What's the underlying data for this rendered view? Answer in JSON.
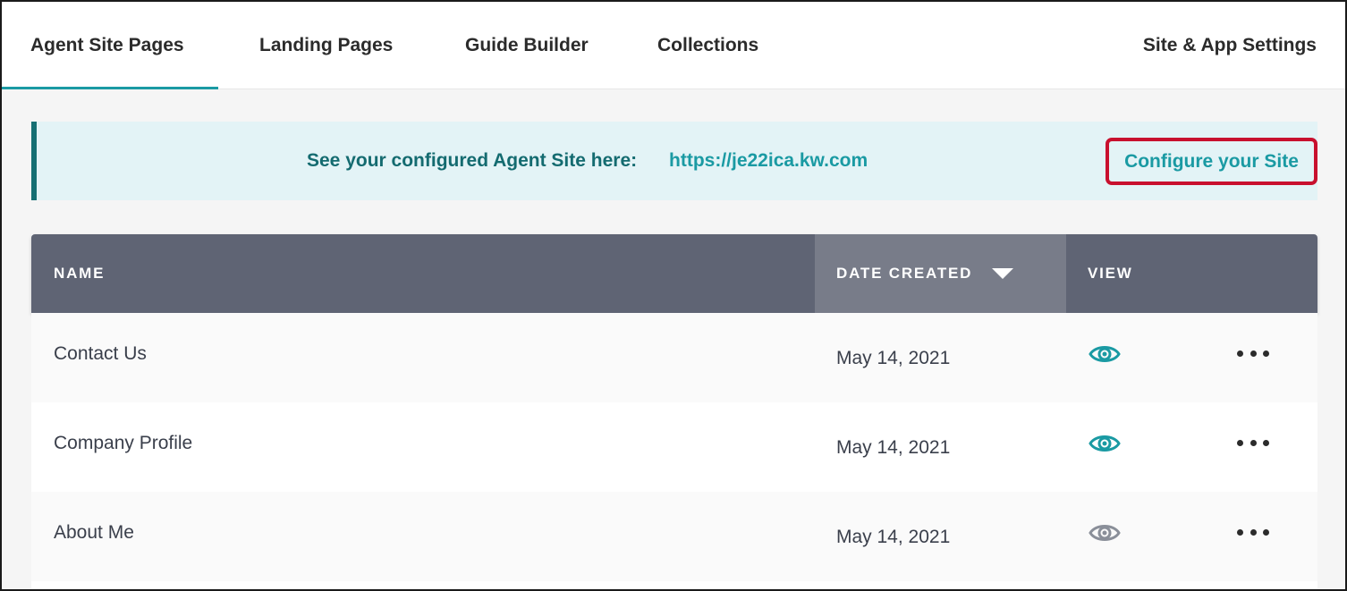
{
  "nav": {
    "tabs": [
      {
        "label": "Agent Site Pages",
        "active": true
      },
      {
        "label": "Landing Pages",
        "active": false
      },
      {
        "label": "Guide Builder",
        "active": false
      },
      {
        "label": "Collections",
        "active": false
      }
    ],
    "settings_label": "Site & App Settings"
  },
  "banner": {
    "text": "See your configured Agent Site here:",
    "link": "https://je22ica.kw.com",
    "configure_label": "Configure your Site"
  },
  "table": {
    "columns": {
      "name": "NAME",
      "date_created": "DATE CREATED",
      "view": "VIEW"
    },
    "sort_icon": "caret-down-icon",
    "rows": [
      {
        "name": "Contact Us",
        "date": "May 14, 2021",
        "view_icon": "eye-icon",
        "view_state": "active"
      },
      {
        "name": "Company Profile",
        "date": "May 14, 2021",
        "view_icon": "eye-icon",
        "view_state": "active"
      },
      {
        "name": "About Me",
        "date": "May 14, 2021",
        "view_icon": "eye-icon",
        "view_state": "inactive"
      }
    ]
  },
  "colors": {
    "accent": "#1a9aa3",
    "banner_bg": "#e3f3f6",
    "banner_border": "#156f73",
    "header_bg": "#5f6474",
    "header_sorted_bg": "#787c89",
    "highlight": "#c8102e",
    "eye_active": "#1a9aa3",
    "eye_inactive": "#8a8f99"
  }
}
